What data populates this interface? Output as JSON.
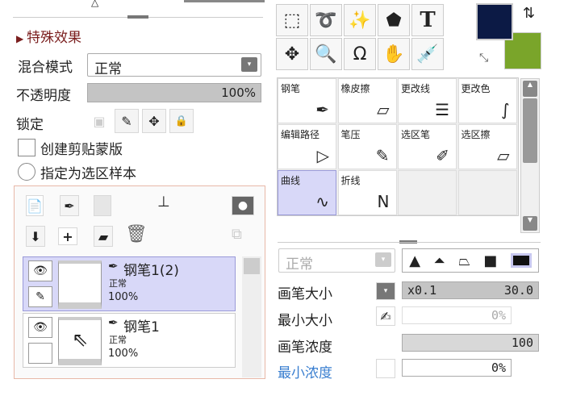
{
  "layer_panel": {
    "section_title": "特殊效果",
    "blend_label": "混合模式",
    "blend_value": "正常",
    "opacity_label": "不透明度",
    "opacity_value": "100%",
    "opacity_percent": 100,
    "lock_label": "锁定",
    "clip_label": "创建剪贴蒙版",
    "sample_label": "指定为选区样本",
    "layers": [
      {
        "name": "钢笔1(2)",
        "mode": "正常",
        "opacity": "100%",
        "selected": true
      },
      {
        "name": "钢笔1",
        "mode": "正常",
        "opacity": "100%",
        "selected": false
      }
    ]
  },
  "tools": {
    "text_tool": "T"
  },
  "colors": {
    "primary": "#0c1a45",
    "secondary": "#7aa52a"
  },
  "brushes": [
    {
      "label": "钢笔",
      "icon": "✒"
    },
    {
      "label": "橡皮擦",
      "icon": "▱"
    },
    {
      "label": "更改线",
      "icon": "☰"
    },
    {
      "label": "更改色",
      "icon": "∫"
    },
    {
      "label": "编辑路径",
      "icon": "▷"
    },
    {
      "label": "笔压",
      "icon": "✎"
    },
    {
      "label": "选区笔",
      "icon": "✐"
    },
    {
      "label": "选区擦",
      "icon": "▱"
    },
    {
      "label": "曲线",
      "icon": "∿"
    },
    {
      "label": "折线",
      "icon": "N"
    }
  ],
  "brush_settings": {
    "mode_value": "正常",
    "size_label": "画笔大小",
    "size_mult": "x0.1",
    "size_value": "30.0",
    "min_size_label": "最小大小",
    "min_size_value": "0%",
    "density_label": "画笔浓度",
    "density_value": "100",
    "min_density_label": "最小浓度",
    "min_density_value": "0%"
  }
}
